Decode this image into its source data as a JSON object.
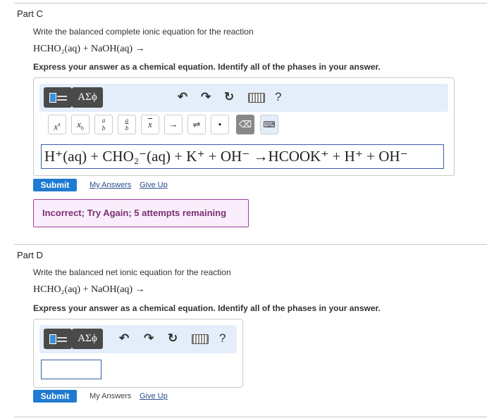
{
  "part_c": {
    "title": "Part C",
    "question": "Write the balanced complete ionic equation for the reaction",
    "reaction": "HCHO₂(aq) + NaOH(aq) →",
    "instruction": "Express your answer as a chemical equation. Identify all of the phases in your answer.",
    "answer": "H⁺(aq) + CHO₂⁻(aq) + K⁺ + OH⁻ →HCOOK⁺ + H⁺ + OH⁻",
    "toolbar": {
      "greek_label": "ΑΣϕ",
      "help_label": "?"
    },
    "symbols": [
      "xᵃ",
      "x_b",
      "a/b",
      "a/b",
      "x̄",
      "→",
      "⇌",
      "•",
      "⌫",
      "⌨"
    ],
    "submit_label": "Submit",
    "my_answers_label": "My Answers",
    "give_up_label": "Give Up",
    "feedback": "Incorrect; Try Again; 5 attempts remaining"
  },
  "part_d": {
    "title": "Part D",
    "question": "Write the balanced net ionic equation for the reaction",
    "reaction": "HCHO₂(aq) + NaOH(aq) →",
    "instruction": "Express your answer as a chemical equation. Identify all of the phases in your answer.",
    "answer": "",
    "toolbar": {
      "greek_label": "ΑΣϕ",
      "help_label": "?"
    },
    "submit_label": "Submit",
    "my_answers_label": "My Answers",
    "give_up_label": "Give Up"
  },
  "colors": {
    "submit_bg": "#1f7ad1",
    "feedback_border": "#9c3f94",
    "feedback_bg": "#fbeefc",
    "toolbar_bg": "#e4eefa"
  }
}
